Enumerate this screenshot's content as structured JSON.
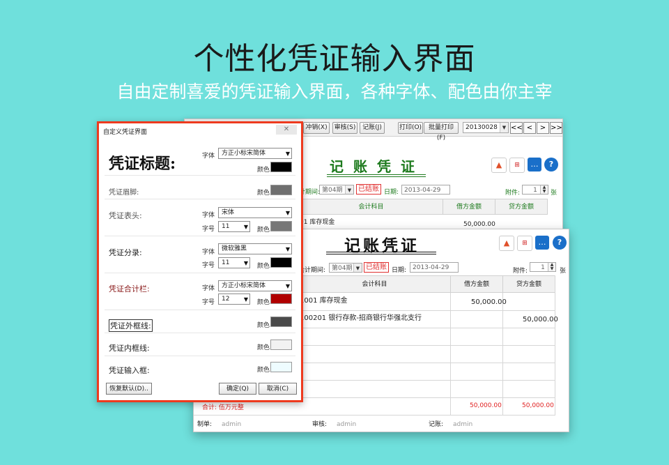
{
  "banner": {
    "title": "个性化凭证输入界面",
    "subtitle": "自由定制喜爱的凭证输入界面，各种字体、配色由你主宰"
  },
  "back_window": {
    "toolbar": {
      "flush": "冲销(X)",
      "audit": "审核(S)",
      "post": "记账(J)",
      "print": "打印(O)",
      "batch_print": "批量打印(F)",
      "voucher_no": "20130028",
      "nav_first": "<<",
      "nav_prev": "<",
      "nav_next": ">",
      "nav_last": ">>"
    },
    "voucher_title": "记账凭证",
    "period_label": "计期间:",
    "period_value": "第04期",
    "status": "已结账",
    "date_label": "日期:",
    "date_value": "2013-04-29",
    "attach_label": "附件:",
    "attach_value": "1",
    "attach_unit": "张",
    "col_subject": "会计科目",
    "col_debit": "借方金额",
    "col_credit": "贷方金额",
    "row1_subject": "01 库存现金",
    "row1_debit": "50,000.00"
  },
  "front_window": {
    "voucher_title": "记账凭证",
    "period_label": "会计期间:",
    "period_value": "第04期",
    "status": "已结账",
    "date_label": "日期:",
    "date_value": "2013-04-29",
    "attach_label": "附件:",
    "attach_value": "1",
    "attach_unit": "张",
    "col_subject": "会计科目",
    "col_debit": "借方金额",
    "col_credit": "贷方金额",
    "rows": [
      {
        "subject": "1001 库存现金",
        "debit": "50,000.00",
        "credit": ""
      },
      {
        "subject": "100201 银行存款-招商银行华强北支行",
        "debit": "",
        "credit": "50,000.00"
      }
    ],
    "total_label": "合计: 伍万元整",
    "total_debit": "50,000.00",
    "total_credit": "50,000.00",
    "maker_label": "制单:",
    "maker": "admin",
    "auditor_label": "审核:",
    "auditor": "admin",
    "poster_label": "记账:",
    "poster": "admin"
  },
  "dialog": {
    "title": "自定义凭证界面",
    "font_label": "字体",
    "size_label": "字号",
    "color_label": "颜色",
    "voucher_title": {
      "label": "凭证标题:",
      "font": "方正小标宋简体",
      "color": "#000000"
    },
    "voucher_footer": {
      "label": "凭证眉脚:",
      "color": "#6f6f6f"
    },
    "voucher_header": {
      "label": "凭证表头:",
      "font": "宋体",
      "size": "11",
      "color": "#777777"
    },
    "voucher_entry": {
      "label": "凭证分录:",
      "font": "微软雅黑",
      "size": "11",
      "color": "#000000"
    },
    "voucher_total": {
      "label": "凭证合计栏:",
      "font": "方正小标宋简体",
      "size": "12",
      "color": "#b00000"
    },
    "outer_frame": {
      "label": "凭证外框线:",
      "color": "#4a4a4a"
    },
    "inner_frame": {
      "label": "凭证内框线:",
      "color": "#f2f2f2"
    },
    "input_box": {
      "label": "凭证输入框:",
      "color": "#eefcff"
    },
    "restore_button": "恢复默认(D)..",
    "ok_button": "确定(Q)",
    "cancel_button": "取消(C)"
  }
}
